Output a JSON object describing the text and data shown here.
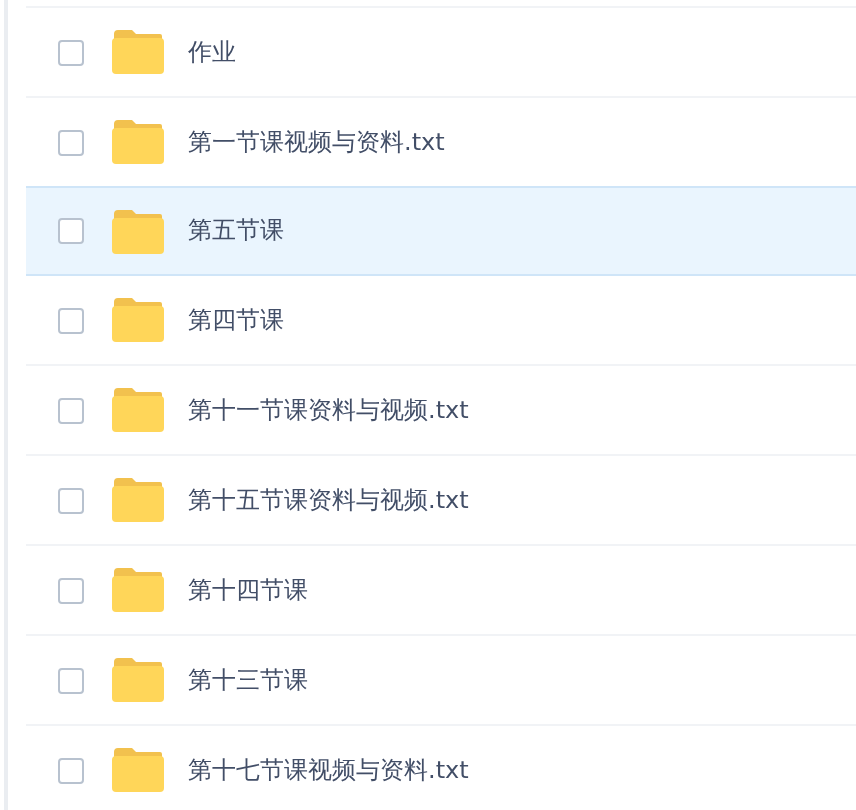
{
  "files": [
    {
      "name": "作业",
      "checked": false,
      "highlighted": false
    },
    {
      "name": "第一节课视频与资料.txt",
      "checked": false,
      "highlighted": false
    },
    {
      "name": "第五节课",
      "checked": false,
      "highlighted": true
    },
    {
      "name": "第四节课",
      "checked": false,
      "highlighted": false
    },
    {
      "name": "第十一节课资料与视频.txt",
      "checked": false,
      "highlighted": false
    },
    {
      "name": "第十五节课资料与视频.txt",
      "checked": false,
      "highlighted": false
    },
    {
      "name": "第十四节课",
      "checked": false,
      "highlighted": false
    },
    {
      "name": "第十三节课",
      "checked": false,
      "highlighted": false
    },
    {
      "name": "第十七节课视频与资料.txt",
      "checked": false,
      "highlighted": false
    }
  ]
}
